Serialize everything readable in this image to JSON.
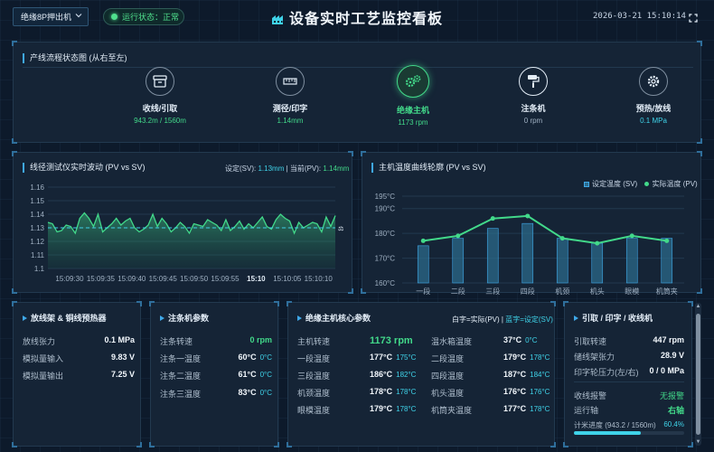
{
  "header": {
    "machine": "绝缘8P押出机",
    "status_label": "运行状态：正常",
    "title": "设备实时工艺监控看板",
    "datetime": "2026-03-21  15:10:14"
  },
  "colors": {
    "accent": "#3fa8e8",
    "green": "#42d98a",
    "cyan": "#3fd2e8",
    "bg": "#0d1a2b",
    "panel": "#152436"
  },
  "flow": {
    "title": "产线流程状态图 (从右至左)",
    "stages": [
      {
        "name": "收线/引取",
        "sub": "943.2m / 1560m",
        "icon": "spool-box-icon",
        "state": "green"
      },
      {
        "name": "测径/印字",
        "sub": "1.14mm",
        "icon": "ruler-icon",
        "state": "green"
      },
      {
        "name": "绝缘主机",
        "sub": "1173 rpm",
        "icon": "gears-icon",
        "state": "active"
      },
      {
        "name": "注条机",
        "sub": "0 rpm",
        "icon": "paint-roller-icon",
        "state": "idle"
      },
      {
        "name": "预热/放线",
        "sub": "0.1 MPa",
        "icon": "cog-icon",
        "state": "cyan"
      }
    ]
  },
  "diameter_chart": {
    "title": "线径测试仪实时波动 (PV vs SV)",
    "sv_prefix": "设定(SV):",
    "sv_value": "1.13mm",
    "pv_prefix": "| 当前(PV):",
    "pv_value": "1.14mm"
  },
  "temp_chart": {
    "title": "主机温度曲线轮廓 (PV vs SV)",
    "legend_set": "设定温度 (SV)",
    "legend_actual": "实际温度 (PV)"
  },
  "chart_data": [
    {
      "type": "area",
      "title": "线径测试仪实时波动 (PV vs SV)",
      "xlabel": "",
      "ylabel": "",
      "ylim": [
        1.1,
        1.16
      ],
      "yticks": [
        "1.16",
        "1.15",
        "1.14",
        "1.13",
        "1.12",
        "1.11",
        "1.1"
      ],
      "x_ticks": [
        "15:09:30",
        "15:09:35",
        "15:09:40",
        "15:09:45",
        "15:09:50",
        "15:09:55",
        "15:10",
        "15:10:05",
        "15:10:10"
      ],
      "highlight_tick": "15:10",
      "setpoint": 1.13,
      "series": [
        {
          "name": "PV",
          "values": [
            1.134,
            1.133,
            1.127,
            1.128,
            1.132,
            1.131,
            1.126,
            1.137,
            1.141,
            1.137,
            1.131,
            1.14,
            1.127,
            1.13,
            1.133,
            1.137,
            1.132,
            1.135,
            1.137,
            1.13,
            1.127,
            1.129,
            1.132,
            1.14,
            1.131,
            1.137,
            1.133,
            1.127,
            1.13,
            1.134,
            1.131,
            1.126,
            1.133,
            1.132,
            1.131,
            1.136,
            1.134,
            1.132,
            1.128,
            1.136,
            1.128,
            1.131,
            1.135,
            1.129,
            1.133,
            1.13,
            1.134,
            1.138,
            1.131,
            1.129,
            1.136,
            1.14,
            1.137,
            1.135,
            1.126,
            1.134,
            1.13,
            1.132,
            1.134,
            1.133,
            1.127,
            1.138,
            1.131,
            1.139
          ]
        }
      ]
    },
    {
      "type": "bar",
      "title": "主机温度曲线轮廓 (PV vs SV)",
      "categories": [
        "一段",
        "二段",
        "三段",
        "四段",
        "机颈",
        "机头",
        "眼模",
        "机筒夹"
      ],
      "yticks": [
        "195°C",
        "190°C",
        "180°C",
        "170°C",
        "160°C"
      ],
      "ylim": [
        160,
        195
      ],
      "series": [
        {
          "name": "设定温度 (SV)",
          "values": [
            175,
            178,
            182,
            184,
            178,
            176,
            178,
            178
          ]
        },
        {
          "name": "实际温度 (PV)",
          "values": [
            177,
            179,
            186,
            187,
            178,
            176,
            179,
            177
          ]
        }
      ]
    }
  ],
  "preheat": {
    "title": "放线架 & 铜线预热器",
    "rows": [
      {
        "label": "放线张力",
        "value": "0.1 MPa"
      },
      {
        "label": "模拟量输入",
        "value": "9.83 V"
      },
      {
        "label": "模拟量输出",
        "value": "7.25 V"
      }
    ]
  },
  "injector": {
    "title": "注条机参数",
    "rows": [
      {
        "label": "注条转速",
        "value": "0 rpm",
        "sv": ""
      },
      {
        "label": "注条一温度",
        "value": "60°C",
        "sv": "0°C"
      },
      {
        "label": "注条二温度",
        "value": "61°C",
        "sv": "0°C"
      },
      {
        "label": "注条三温度",
        "value": "83°C",
        "sv": "0°C"
      }
    ]
  },
  "main_core": {
    "title": "绝缘主机核心参数",
    "legend_white": "白字=实际(PV)",
    "legend_blue": "蓝字=设定(SV)",
    "left": [
      {
        "label": "主机转速",
        "value": "1173 rpm",
        "sv": ""
      },
      {
        "label": "一段温度",
        "value": "177°C",
        "sv": "175°C"
      },
      {
        "label": "三段温度",
        "value": "186°C",
        "sv": "182°C"
      },
      {
        "label": "机颈温度",
        "value": "178°C",
        "sv": "178°C"
      },
      {
        "label": "眼模温度",
        "value": "179°C",
        "sv": "178°C"
      }
    ],
    "right": [
      {
        "label": "温水箱温度",
        "value": "37°C",
        "sv": "0°C"
      },
      {
        "label": "二段温度",
        "value": "179°C",
        "sv": "178°C"
      },
      {
        "label": "四段温度",
        "value": "187°C",
        "sv": "184°C"
      },
      {
        "label": "机头温度",
        "value": "176°C",
        "sv": "176°C"
      },
      {
        "label": "机筒夹温度",
        "value": "177°C",
        "sv": "178°C"
      }
    ]
  },
  "takeup": {
    "title": "引取 / 印字 / 收线机",
    "rows": [
      {
        "label": "引取转速",
        "value": "447 rpm"
      },
      {
        "label": "储线架张力",
        "value": "28.9 V"
      },
      {
        "label": "印字轮压力(左/右)",
        "value": "0 / 0 MPa"
      }
    ],
    "rows2": [
      {
        "label": "收线报警",
        "value": "无报警"
      },
      {
        "label": "运行轴",
        "value": "右轴"
      }
    ],
    "progress_label": "计米进度 (943.2 / 1560m)",
    "progress_value": "60.4%",
    "progress_fraction": 0.604
  }
}
